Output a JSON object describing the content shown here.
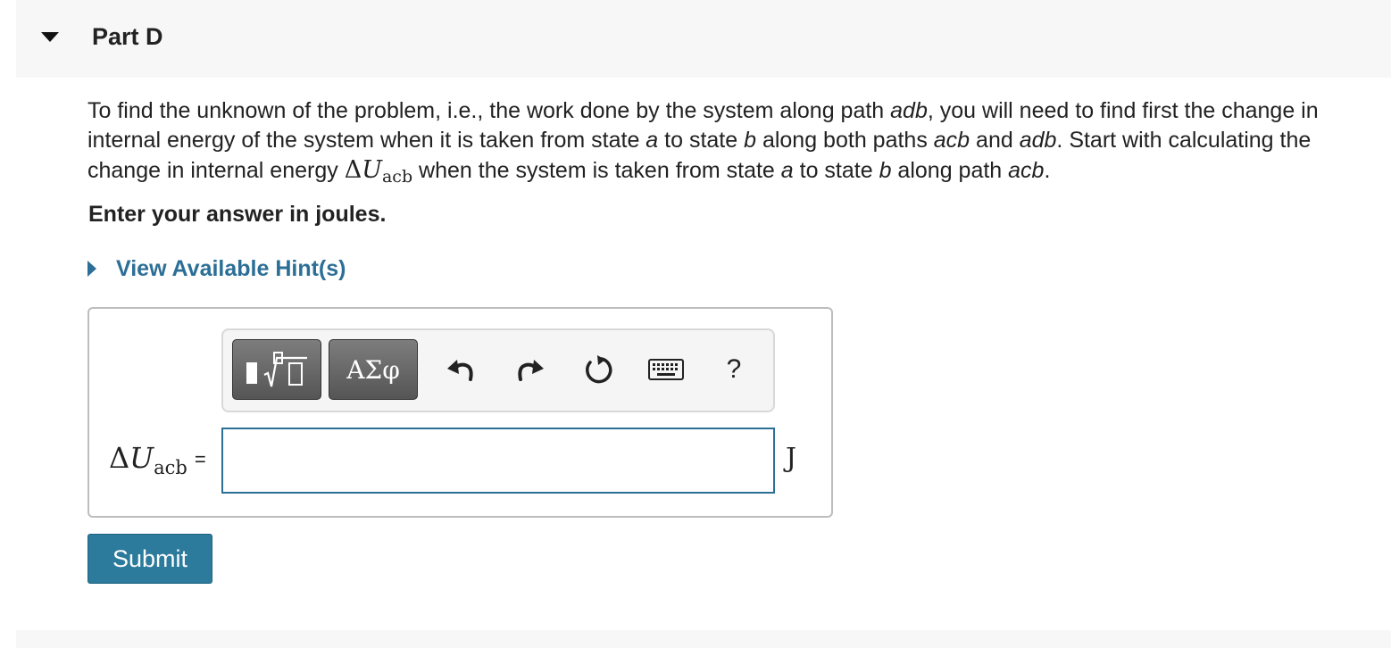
{
  "part": {
    "title": "Part D"
  },
  "problem": {
    "s1": "To find the unknown of the problem, i.e., the work done by the system along path ",
    "path_adb": "adb",
    "s2": ", you will need to find first the change in internal energy of the system when it is taken from state ",
    "state_a": "a",
    "s3": " to state ",
    "state_b": "b",
    "s4": " along both paths ",
    "path_acb": "acb",
    "s5": " and ",
    "s6": ". Start with calculating the change in internal energy ",
    "delta": "Δ",
    "U": "U",
    "sub": "acb",
    "s7": " when the system is taken from state ",
    "s8": " along path ",
    "end": "."
  },
  "instruction": "Enter your answer in joules.",
  "hint": {
    "label": "View Available Hint(s)"
  },
  "toolbar": {
    "symbols_label": "ΑΣφ",
    "help_label": "?",
    "icons": [
      "templates-icon",
      "undo-icon",
      "redo-icon",
      "reset-icon",
      "keyboard-icon"
    ]
  },
  "answer": {
    "label_delta": "Δ",
    "label_U": "U",
    "label_sub": "acb",
    "label_eq": "=",
    "value": "",
    "unit": "J"
  },
  "submit_label": "Submit",
  "colors": {
    "link": "#2c6f96",
    "submit": "#2c7a9c",
    "input_border": "#2c6f96"
  }
}
